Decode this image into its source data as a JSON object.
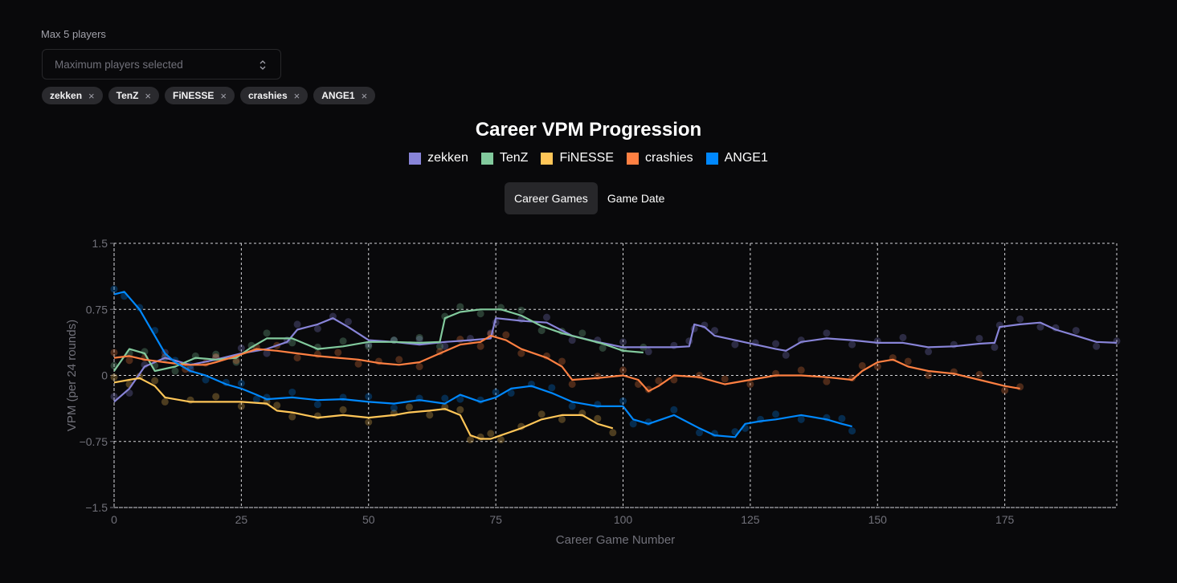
{
  "controls": {
    "limit_label": "Max 5 players",
    "select_placeholder": "Maximum players selected",
    "selected_players": [
      "zekken",
      "TenZ",
      "FiNESSE",
      "crashies",
      "ANGE1"
    ],
    "remove_icon": "×",
    "toggle": [
      "Career Games",
      "Game Date"
    ],
    "active_toggle": "Career Games"
  },
  "colors": {
    "background": "#09090b",
    "grid": "#d4d4d8",
    "axis_text": "#71717a"
  },
  "chart_data": {
    "type": "line",
    "title": "Career VPM Progression",
    "xlabel": "Career Game Number",
    "ylabel": "VPM (per 24 rounds)",
    "xlim": [
      0,
      197
    ],
    "ylim": [
      -1.5,
      1.5
    ],
    "xticks": [
      0,
      25,
      50,
      75,
      100,
      125,
      150,
      175
    ],
    "yticks": [
      1.5,
      0.75,
      0,
      -0.75,
      -1.5
    ],
    "ytick_labels": [
      "1.5",
      "0.75",
      "0",
      "−0.75",
      "−1.5"
    ],
    "grid": true,
    "legend_position": "top-center",
    "series": [
      {
        "name": "zekken",
        "color": "#8884d8",
        "points": [
          [
            0,
            -0.3
          ],
          [
            3,
            -0.15
          ],
          [
            6,
            0.1
          ],
          [
            10,
            0.2
          ],
          [
            15,
            0.12
          ],
          [
            20,
            0.18
          ],
          [
            25,
            0.25
          ],
          [
            30,
            0.3
          ],
          [
            34,
            0.38
          ],
          [
            36,
            0.52
          ],
          [
            40,
            0.58
          ],
          [
            43,
            0.65
          ],
          [
            46,
            0.55
          ],
          [
            50,
            0.4
          ],
          [
            55,
            0.38
          ],
          [
            60,
            0.35
          ],
          [
            65,
            0.38
          ],
          [
            70,
            0.4
          ],
          [
            74,
            0.42
          ],
          [
            75,
            0.65
          ],
          [
            80,
            0.62
          ],
          [
            85,
            0.6
          ],
          [
            90,
            0.45
          ],
          [
            95,
            0.38
          ],
          [
            100,
            0.32
          ],
          [
            105,
            0.32
          ],
          [
            110,
            0.32
          ],
          [
            113,
            0.33
          ],
          [
            114,
            0.58
          ],
          [
            116,
            0.55
          ],
          [
            118,
            0.45
          ],
          [
            122,
            0.4
          ],
          [
            126,
            0.35
          ],
          [
            130,
            0.3
          ],
          [
            132,
            0.28
          ],
          [
            135,
            0.38
          ],
          [
            140,
            0.42
          ],
          [
            145,
            0.4
          ],
          [
            150,
            0.37
          ],
          [
            155,
            0.37
          ],
          [
            160,
            0.32
          ],
          [
            165,
            0.33
          ],
          [
            170,
            0.36
          ],
          [
            173,
            0.37
          ],
          [
            174,
            0.55
          ],
          [
            178,
            0.58
          ],
          [
            182,
            0.6
          ],
          [
            185,
            0.52
          ],
          [
            189,
            0.45
          ],
          [
            193,
            0.38
          ],
          [
            197,
            0.37
          ]
        ]
      },
      {
        "name": "TenZ",
        "color": "#82ca9d",
        "points": [
          [
            0,
            0.05
          ],
          [
            3,
            0.3
          ],
          [
            6,
            0.25
          ],
          [
            8,
            0.05
          ],
          [
            12,
            0.1
          ],
          [
            16,
            0.2
          ],
          [
            20,
            0.18
          ],
          [
            24,
            0.2
          ],
          [
            27,
            0.32
          ],
          [
            30,
            0.42
          ],
          [
            35,
            0.42
          ],
          [
            40,
            0.3
          ],
          [
            45,
            0.33
          ],
          [
            50,
            0.38
          ],
          [
            55,
            0.38
          ],
          [
            60,
            0.37
          ],
          [
            64,
            0.38
          ],
          [
            65,
            0.65
          ],
          [
            68,
            0.72
          ],
          [
            72,
            0.75
          ],
          [
            76,
            0.75
          ],
          [
            80,
            0.68
          ],
          [
            84,
            0.56
          ],
          [
            88,
            0.48
          ],
          [
            92,
            0.42
          ],
          [
            96,
            0.36
          ],
          [
            100,
            0.28
          ],
          [
            104,
            0.26
          ]
        ]
      },
      {
        "name": "FiNESSE",
        "color": "#ffc658",
        "points": [
          [
            0,
            -0.08
          ],
          [
            3,
            -0.05
          ],
          [
            5,
            -0.03
          ],
          [
            8,
            -0.12
          ],
          [
            10,
            -0.25
          ],
          [
            15,
            -0.3
          ],
          [
            20,
            -0.3
          ],
          [
            25,
            -0.3
          ],
          [
            30,
            -0.32
          ],
          [
            32,
            -0.4
          ],
          [
            35,
            -0.42
          ],
          [
            40,
            -0.48
          ],
          [
            45,
            -0.45
          ],
          [
            50,
            -0.48
          ],
          [
            55,
            -0.45
          ],
          [
            58,
            -0.42
          ],
          [
            62,
            -0.4
          ],
          [
            65,
            -0.38
          ],
          [
            68,
            -0.45
          ],
          [
            70,
            -0.68
          ],
          [
            72,
            -0.72
          ],
          [
            74,
            -0.72
          ],
          [
            76,
            -0.68
          ],
          [
            80,
            -0.6
          ],
          [
            84,
            -0.5
          ],
          [
            88,
            -0.45
          ],
          [
            92,
            -0.45
          ],
          [
            95,
            -0.55
          ],
          [
            98,
            -0.6
          ]
        ]
      },
      {
        "name": "crashies",
        "color": "#ff8042",
        "points": [
          [
            0,
            0.2
          ],
          [
            3,
            0.22
          ],
          [
            6,
            0.18
          ],
          [
            10,
            0.15
          ],
          [
            14,
            0.12
          ],
          [
            18,
            0.12
          ],
          [
            20,
            0.15
          ],
          [
            24,
            0.22
          ],
          [
            28,
            0.3
          ],
          [
            32,
            0.28
          ],
          [
            36,
            0.25
          ],
          [
            40,
            0.22
          ],
          [
            44,
            0.2
          ],
          [
            48,
            0.18
          ],
          [
            52,
            0.14
          ],
          [
            56,
            0.12
          ],
          [
            60,
            0.15
          ],
          [
            64,
            0.25
          ],
          [
            68,
            0.35
          ],
          [
            72,
            0.38
          ],
          [
            74,
            0.45
          ],
          [
            77,
            0.4
          ],
          [
            80,
            0.3
          ],
          [
            85,
            0.2
          ],
          [
            88,
            0.1
          ],
          [
            90,
            -0.05
          ],
          [
            95,
            -0.03
          ],
          [
            100,
            0.0
          ],
          [
            103,
            -0.05
          ],
          [
            105,
            -0.18
          ],
          [
            107,
            -0.12
          ],
          [
            110,
            0.0
          ],
          [
            115,
            -0.02
          ],
          [
            120,
            -0.1
          ],
          [
            125,
            -0.05
          ],
          [
            130,
            0.0
          ],
          [
            135,
            0.0
          ],
          [
            140,
            -0.02
          ],
          [
            145,
            -0.05
          ],
          [
            147,
            0.05
          ],
          [
            150,
            0.15
          ],
          [
            153,
            0.18
          ],
          [
            156,
            0.1
          ],
          [
            160,
            0.05
          ],
          [
            165,
            0.02
          ],
          [
            170,
            -0.05
          ],
          [
            175,
            -0.12
          ],
          [
            178,
            -0.15
          ]
        ]
      },
      {
        "name": "ANGE1",
        "color": "#0088fe",
        "points": [
          [
            0,
            0.92
          ],
          [
            2,
            0.95
          ],
          [
            5,
            0.75
          ],
          [
            8,
            0.45
          ],
          [
            10,
            0.25
          ],
          [
            12,
            0.15
          ],
          [
            15,
            0.05
          ],
          [
            18,
            0.0
          ],
          [
            22,
            -0.1
          ],
          [
            25,
            -0.15
          ],
          [
            28,
            -0.22
          ],
          [
            30,
            -0.27
          ],
          [
            35,
            -0.25
          ],
          [
            40,
            -0.28
          ],
          [
            45,
            -0.27
          ],
          [
            50,
            -0.3
          ],
          [
            55,
            -0.32
          ],
          [
            60,
            -0.28
          ],
          [
            65,
            -0.32
          ],
          [
            68,
            -0.22
          ],
          [
            72,
            -0.3
          ],
          [
            75,
            -0.25
          ],
          [
            78,
            -0.15
          ],
          [
            82,
            -0.12
          ],
          [
            86,
            -0.2
          ],
          [
            90,
            -0.3
          ],
          [
            95,
            -0.35
          ],
          [
            100,
            -0.35
          ],
          [
            102,
            -0.5
          ],
          [
            105,
            -0.55
          ],
          [
            110,
            -0.45
          ],
          [
            115,
            -0.6
          ],
          [
            118,
            -0.68
          ],
          [
            122,
            -0.7
          ],
          [
            124,
            -0.55
          ],
          [
            127,
            -0.52
          ],
          [
            130,
            -0.5
          ],
          [
            135,
            -0.45
          ],
          [
            140,
            -0.5
          ],
          [
            143,
            -0.55
          ],
          [
            145,
            -0.58
          ]
        ]
      }
    ]
  }
}
